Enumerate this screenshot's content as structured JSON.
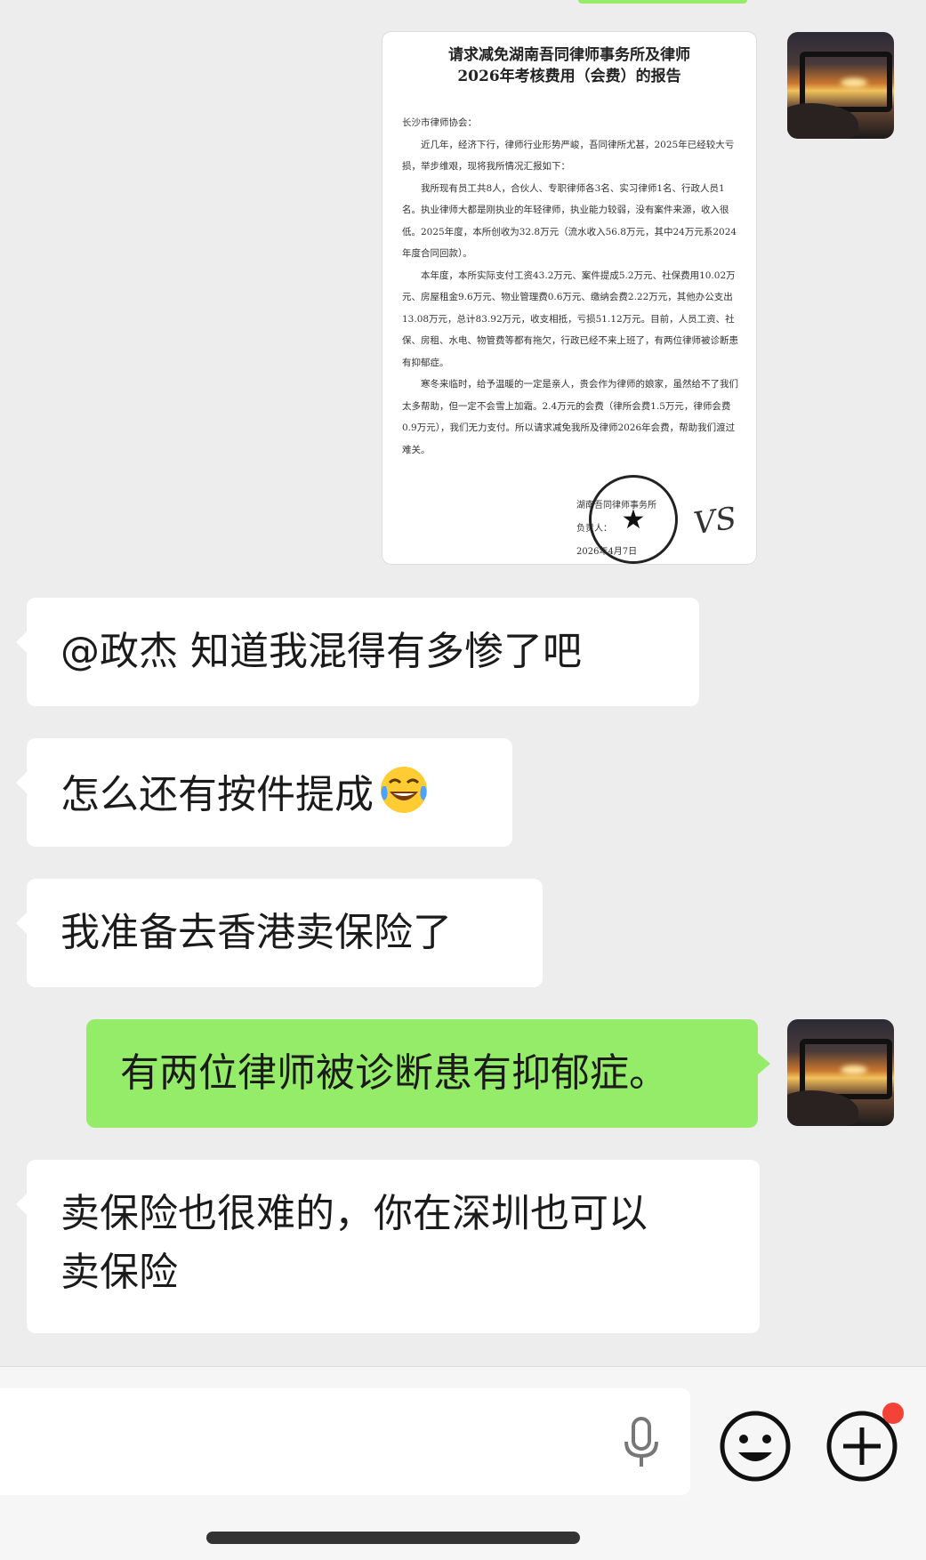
{
  "document": {
    "title_line1": "请求减免湖南吾同律师事务所及律师",
    "title_line2": "2026年考核费用（会费）的报告",
    "salutation": "长沙市律师协会：",
    "paragraphs": [
      "近几年，经济下行，律师行业形势严峻，吾同律所尤甚，2025年已经较大亏损，举步维艰，现将我所情况汇报如下：",
      "我所现有员工共8人，合伙人、专职律师各3名、实习律师1名、行政人员1名。执业律师大都是刚执业的年轻律师，执业能力较弱，没有案件来源，收入很低。2025年度，本所创收为32.8万元（流水收入56.8万元，其中24万元系2024年度合同回款）。",
      "本年度，本所实际支付工资43.2万元、案件提成5.2万元、社保费用10.02万元、房屋租金9.6万元、物业管理费0.6万元、缴纳会费2.22万元，其他办公支出13.08万元，总计83.92万元，收支相抵，亏损51.12万元。目前，人员工资、社保、房租、水电、物管费等都有拖欠，行政已经不来上班了，有两位律师被诊断患有抑郁症。",
      "寒冬来临时，给予温暖的一定是亲人，贵会作为律师的娘家，虽然给不了我们太多帮助，但一定不会雪上加霜。2.4万元的会费（律所会费1.5万元，律师会费0.9万元），我们无力支付。所以请求减免我所及律师2026年会费，帮助我们渡过难关。"
    ],
    "sign_org": "湖南吾同律师事务所",
    "sign_person": "负责人：",
    "sign_date": "2026年4月7日",
    "signature": "VS"
  },
  "messages": [
    {
      "side": "left",
      "text": "@政杰  知道我混得有多惨了吧"
    },
    {
      "side": "left",
      "text": "怎么还有按件提成",
      "emoji": "tears-of-joy"
    },
    {
      "side": "left",
      "text": "我准备去香港卖保险了"
    },
    {
      "side": "right",
      "text": "有两位律师被诊断患有抑郁症。"
    },
    {
      "side": "left",
      "text_line1": "卖保险也很难的，你在深圳也可以",
      "text_line2": "卖保险"
    }
  ],
  "input_bar": {
    "icons": [
      "microphone-icon",
      "emoji-icon",
      "plus-icon"
    ],
    "notification_dot_color": "#f44336"
  },
  "colors": {
    "background": "#ededed",
    "bubble_self": "#95ec69",
    "bubble_other": "#ffffff"
  }
}
